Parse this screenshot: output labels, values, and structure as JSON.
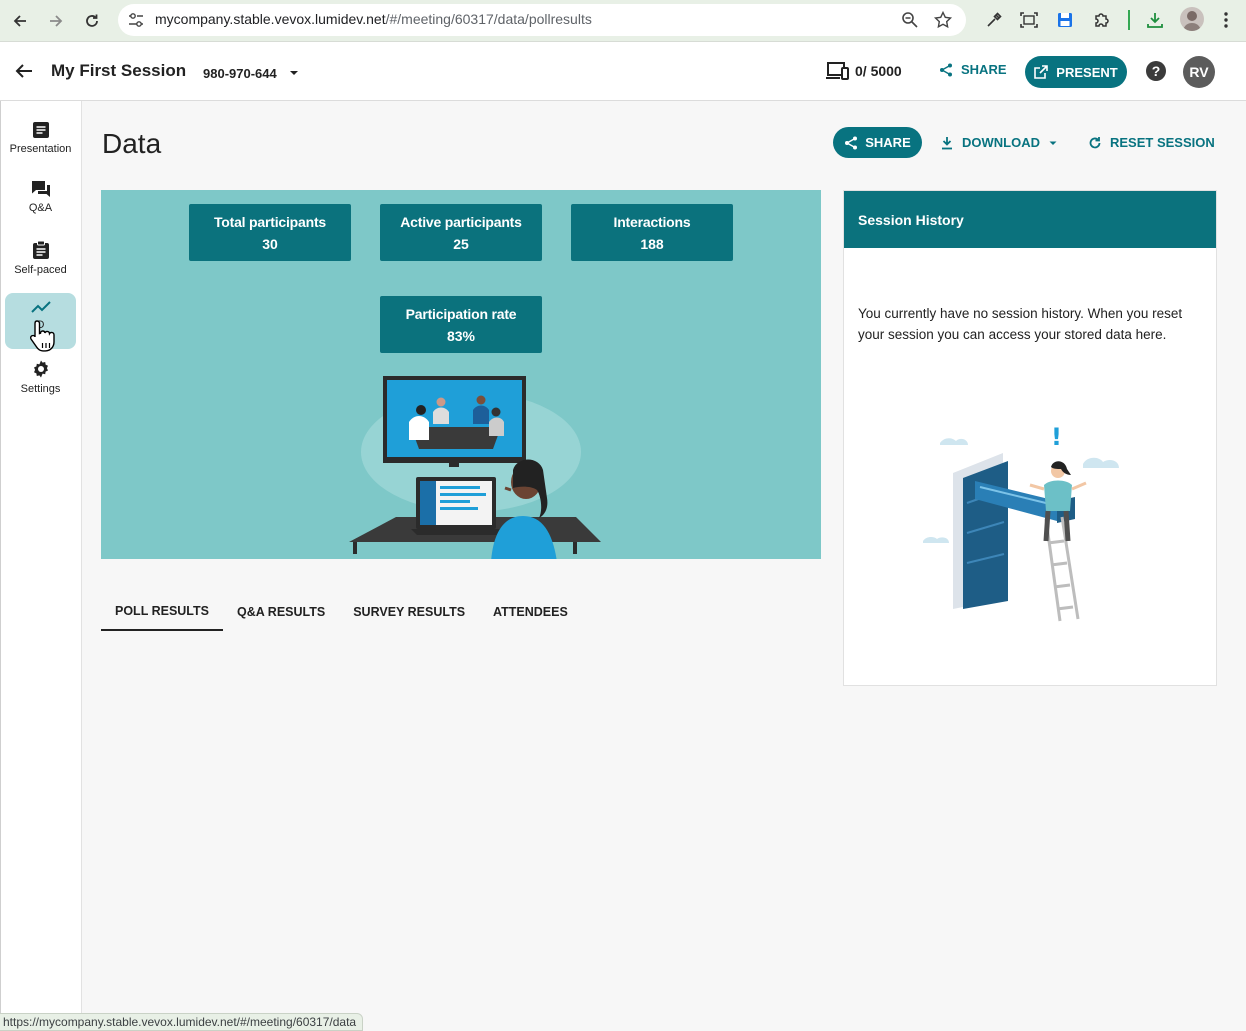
{
  "browser": {
    "url_host": "mycompany.stable.vevox.lumidev.net",
    "url_path": "/#/meeting/60317/data/pollresults",
    "status_url": "https://mycompany.stable.vevox.lumidev.net/#/meeting/60317/data"
  },
  "header": {
    "title": "My First Session",
    "session_code": "980-970-644",
    "device_count": "0/ 5000",
    "share_label": "SHARE",
    "present_label": "PRESENT",
    "help_label": "?",
    "avatar_initials": "RV"
  },
  "sidebar": {
    "items": [
      {
        "label": "Presentation",
        "icon": "presentation-icon"
      },
      {
        "label": "Q&A",
        "icon": "chat-icon"
      },
      {
        "label": "Self-paced",
        "icon": "clipboard-icon"
      },
      {
        "label": "D",
        "icon": "chart-line-icon"
      },
      {
        "label": "Settings",
        "icon": "gear-icon"
      }
    ]
  },
  "main": {
    "title": "Data",
    "share_label": "SHARE",
    "download_label": "DOWNLOAD",
    "reset_label": "RESET SESSION",
    "stats": [
      {
        "label": "Total participants",
        "value": "30"
      },
      {
        "label": "Active participants",
        "value": "25"
      },
      {
        "label": "Interactions",
        "value": "188"
      },
      {
        "label": "Participation rate",
        "value": "83%"
      }
    ],
    "tabs": [
      "POLL RESULTS",
      "Q&A RESULTS",
      "SURVEY RESULTS",
      "ATTENDEES"
    ]
  },
  "history": {
    "title": "Session History",
    "message": "You currently have no session history. When you reset your session you can access your stored data here."
  },
  "colors": {
    "teal": "#087380",
    "panel": "#7ec8c8",
    "active_nav": "#b6dde0"
  }
}
